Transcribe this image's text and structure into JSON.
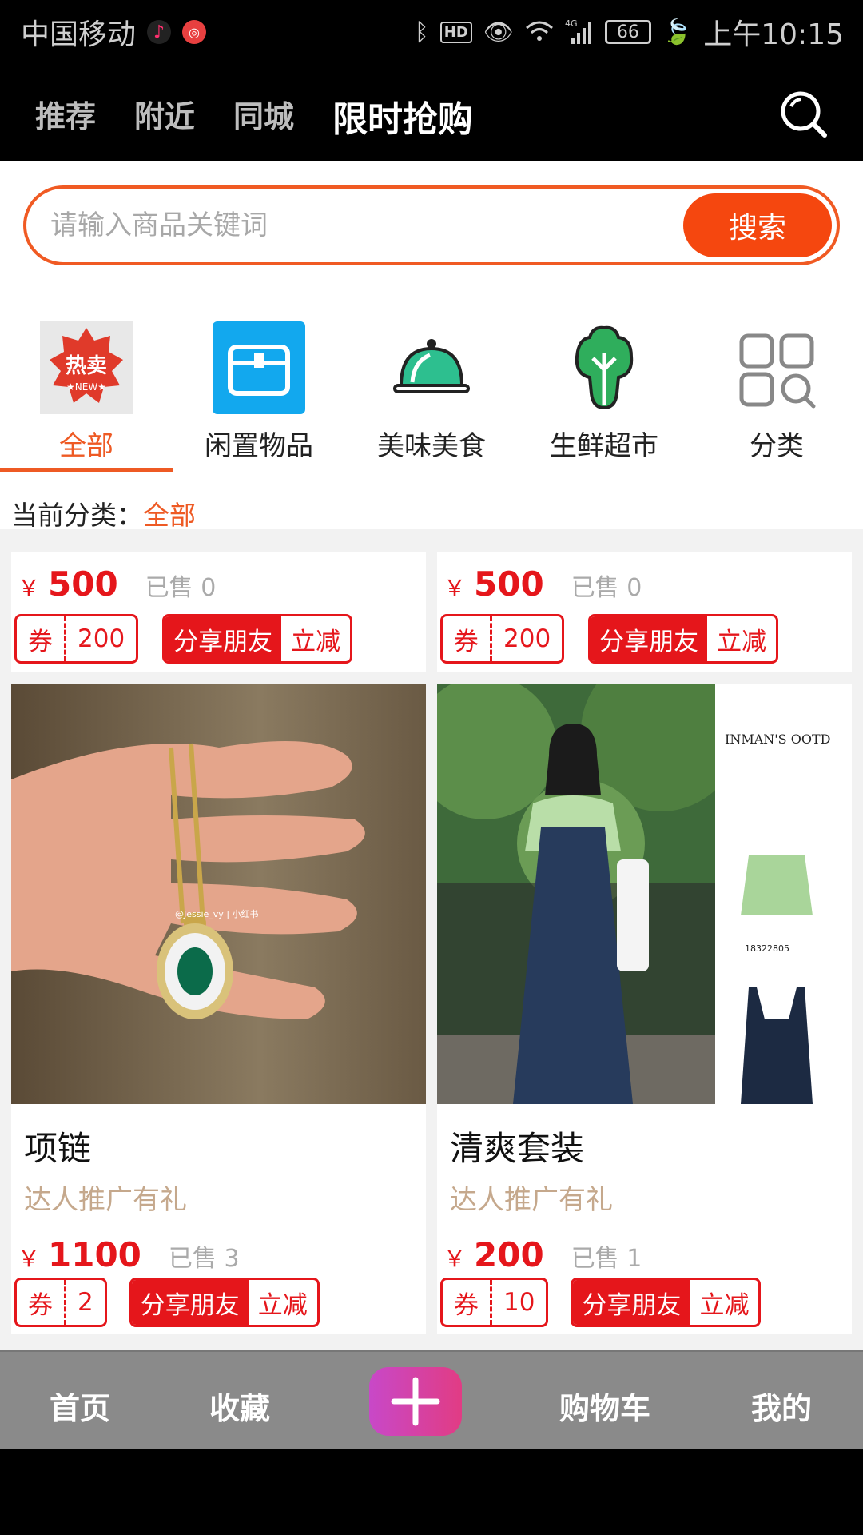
{
  "status_bar": {
    "carrier": "中国移动",
    "time": "上午10:15",
    "battery": "66",
    "network": "4G",
    "icons": [
      "tiktok-icon",
      "app-icon",
      "bluetooth-icon",
      "hd-icon",
      "eye-icon",
      "wifi-icon",
      "signal-icon",
      "battery-icon",
      "leaf-icon"
    ]
  },
  "top_nav": {
    "tabs": [
      {
        "label": "推荐"
      },
      {
        "label": "附近"
      },
      {
        "label": "同城"
      },
      {
        "label": "限时抢购"
      }
    ],
    "active_index": 3
  },
  "search": {
    "placeholder": "请输入商品关键词",
    "button_label": "搜索"
  },
  "categories": {
    "items": [
      {
        "label": "全部",
        "icon": "hot-sale-icon",
        "badge_text": "热卖",
        "badge_sub": "★NEW★"
      },
      {
        "label": "闲置物品",
        "icon": "box-icon"
      },
      {
        "label": "美味美食",
        "icon": "food-cover-icon"
      },
      {
        "label": "生鲜超市",
        "icon": "vegetable-icon"
      },
      {
        "label": "分类",
        "icon": "grid-icon"
      }
    ],
    "active_index": 0
  },
  "current_category": {
    "prefix": "当前分类：",
    "value": "全部"
  },
  "products": [
    {
      "title": "",
      "subtitle": "",
      "currency": "￥",
      "price": "500",
      "sold": "已售 0",
      "coupon_label": "券",
      "coupon_value": "200",
      "share_label": "分享朋友",
      "discount_label": "立减"
    },
    {
      "title": "",
      "subtitle": "",
      "currency": "￥",
      "price": "500",
      "sold": "已售 0",
      "coupon_label": "券",
      "coupon_value": "200",
      "share_label": "分享朋友",
      "discount_label": "立减"
    },
    {
      "title": "项链",
      "subtitle": "达人推广有礼",
      "currency": "￥",
      "price": "1100",
      "sold": "已售 3",
      "coupon_label": "券",
      "coupon_value": "2",
      "share_label": "分享朋友",
      "discount_label": "立减",
      "image_watermark": "@Jessie_vy | 小红书"
    },
    {
      "title": "清爽套装",
      "subtitle": "达人推广有礼",
      "currency": "￥",
      "price": "200",
      "sold": "已售 1",
      "coupon_label": "券",
      "coupon_value": "10",
      "share_label": "分享朋友",
      "discount_label": "立减",
      "image_text_title": "INMAN'S OOTD",
      "image_text_code": "18322805"
    }
  ],
  "bottom_nav": {
    "items": [
      {
        "label": "首页"
      },
      {
        "label": "收藏"
      },
      {
        "label": "购物车"
      },
      {
        "label": "我的"
      }
    ]
  },
  "colors": {
    "accent": "#ee5a24",
    "price_red": "#e5161b",
    "search_button": "#f5470f",
    "bottom_nav_bg": "#8a8a8a"
  }
}
